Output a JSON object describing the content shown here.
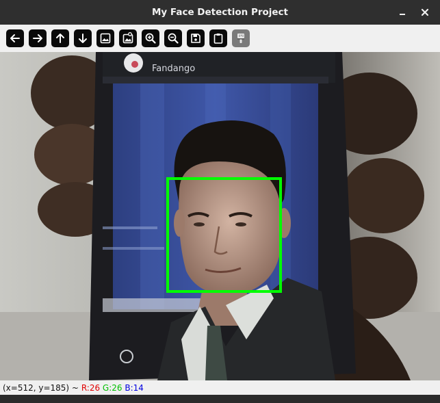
{
  "window": {
    "title": "My Face Detection Project",
    "controls": {
      "minimize": "minimize-icon",
      "close": "close-icon"
    }
  },
  "toolbar": {
    "buttons": [
      {
        "name": "pan-left",
        "icon": "arrow-left-icon"
      },
      {
        "name": "pan-right",
        "icon": "arrow-right-icon"
      },
      {
        "name": "pan-up",
        "icon": "arrow-up-icon"
      },
      {
        "name": "pan-down",
        "icon": "arrow-down-icon"
      },
      {
        "name": "zoom-original",
        "icon": "image-icon"
      },
      {
        "name": "zoom-fit",
        "icon": "image-fit-icon"
      },
      {
        "name": "zoom-in",
        "icon": "zoom-in-icon"
      },
      {
        "name": "zoom-out",
        "icon": "zoom-out-icon"
      },
      {
        "name": "save-image",
        "icon": "save-icon"
      },
      {
        "name": "copy-to-clipboard",
        "icon": "clipboard-icon"
      },
      {
        "name": "properties",
        "icon": "paint-brush-icon",
        "disabled": true
      }
    ]
  },
  "image": {
    "phone_app_label": "Fandango",
    "detection_box_color": "#00ff00"
  },
  "status": {
    "coords": "(x=512, y=185) ~",
    "r": "R:26",
    "g": "G:26",
    "b": "B:14",
    "colors": {
      "r": "#e00000",
      "g": "#00c000",
      "b": "#0000e0"
    }
  }
}
